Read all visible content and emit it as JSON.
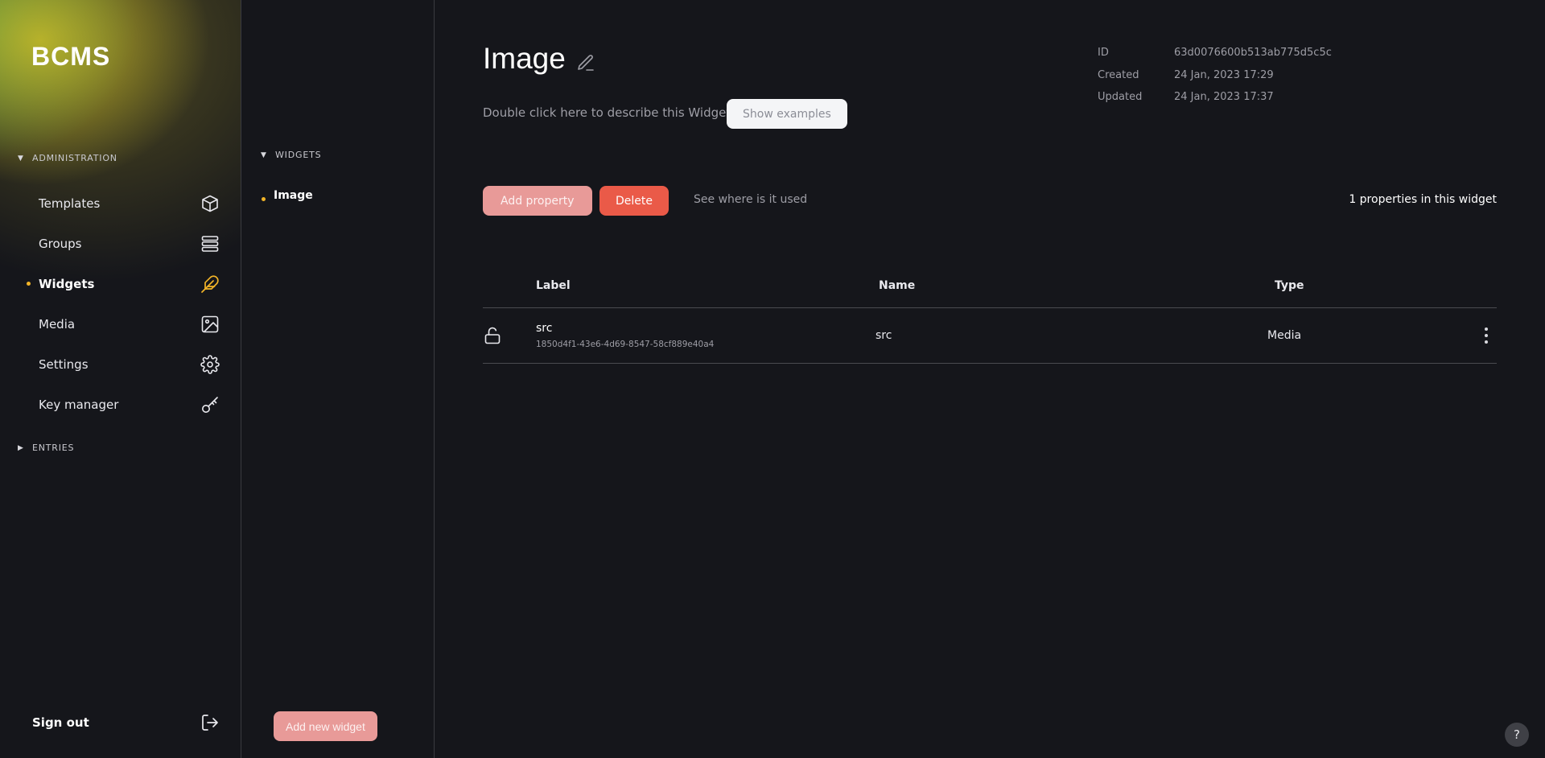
{
  "app": {
    "logo": "BCMS"
  },
  "sidebar": {
    "administration_label": "ADMINISTRATION",
    "entries_label": "ENTRIES",
    "items": [
      {
        "label": "Templates",
        "icon": "cube-icon"
      },
      {
        "label": "Groups",
        "icon": "layers-icon"
      },
      {
        "label": "Widgets",
        "icon": "feather-icon",
        "active": true
      },
      {
        "label": "Media",
        "icon": "image-icon"
      },
      {
        "label": "Settings",
        "icon": "gear-icon"
      },
      {
        "label": "Key manager",
        "icon": "key-icon"
      }
    ],
    "sign_out": "Sign out"
  },
  "widgets_panel": {
    "header": "WIDGETS",
    "items": [
      {
        "label": "Image",
        "active": true
      }
    ],
    "add_button": "Add new widget"
  },
  "main": {
    "title": "Image",
    "description_placeholder": "Double click here to describe this Widget",
    "show_examples": "Show examples",
    "meta": {
      "id_label": "ID",
      "id_value": "63d0076600b513ab775d5c5c",
      "created_label": "Created",
      "created_value": "24 Jan, 2023 17:29",
      "updated_label": "Updated",
      "updated_value": "24 Jan, 2023 17:37"
    },
    "add_property": "Add property",
    "delete": "Delete",
    "see_where_used": "See where is it used",
    "properties_count": "1 properties in this widget",
    "table": {
      "columns": [
        "Label",
        "Name",
        "Type"
      ],
      "rows": [
        {
          "label": "src",
          "id": "1850d4f1-43e6-4d69-8547-58cf889e40a4",
          "name": "src",
          "type": "Media"
        }
      ]
    }
  },
  "help_label": "?",
  "colors": {
    "accent_dot": "#f2b428",
    "primary_light": "#e89a98",
    "danger": "#ea5a48",
    "background": "#15161b"
  }
}
